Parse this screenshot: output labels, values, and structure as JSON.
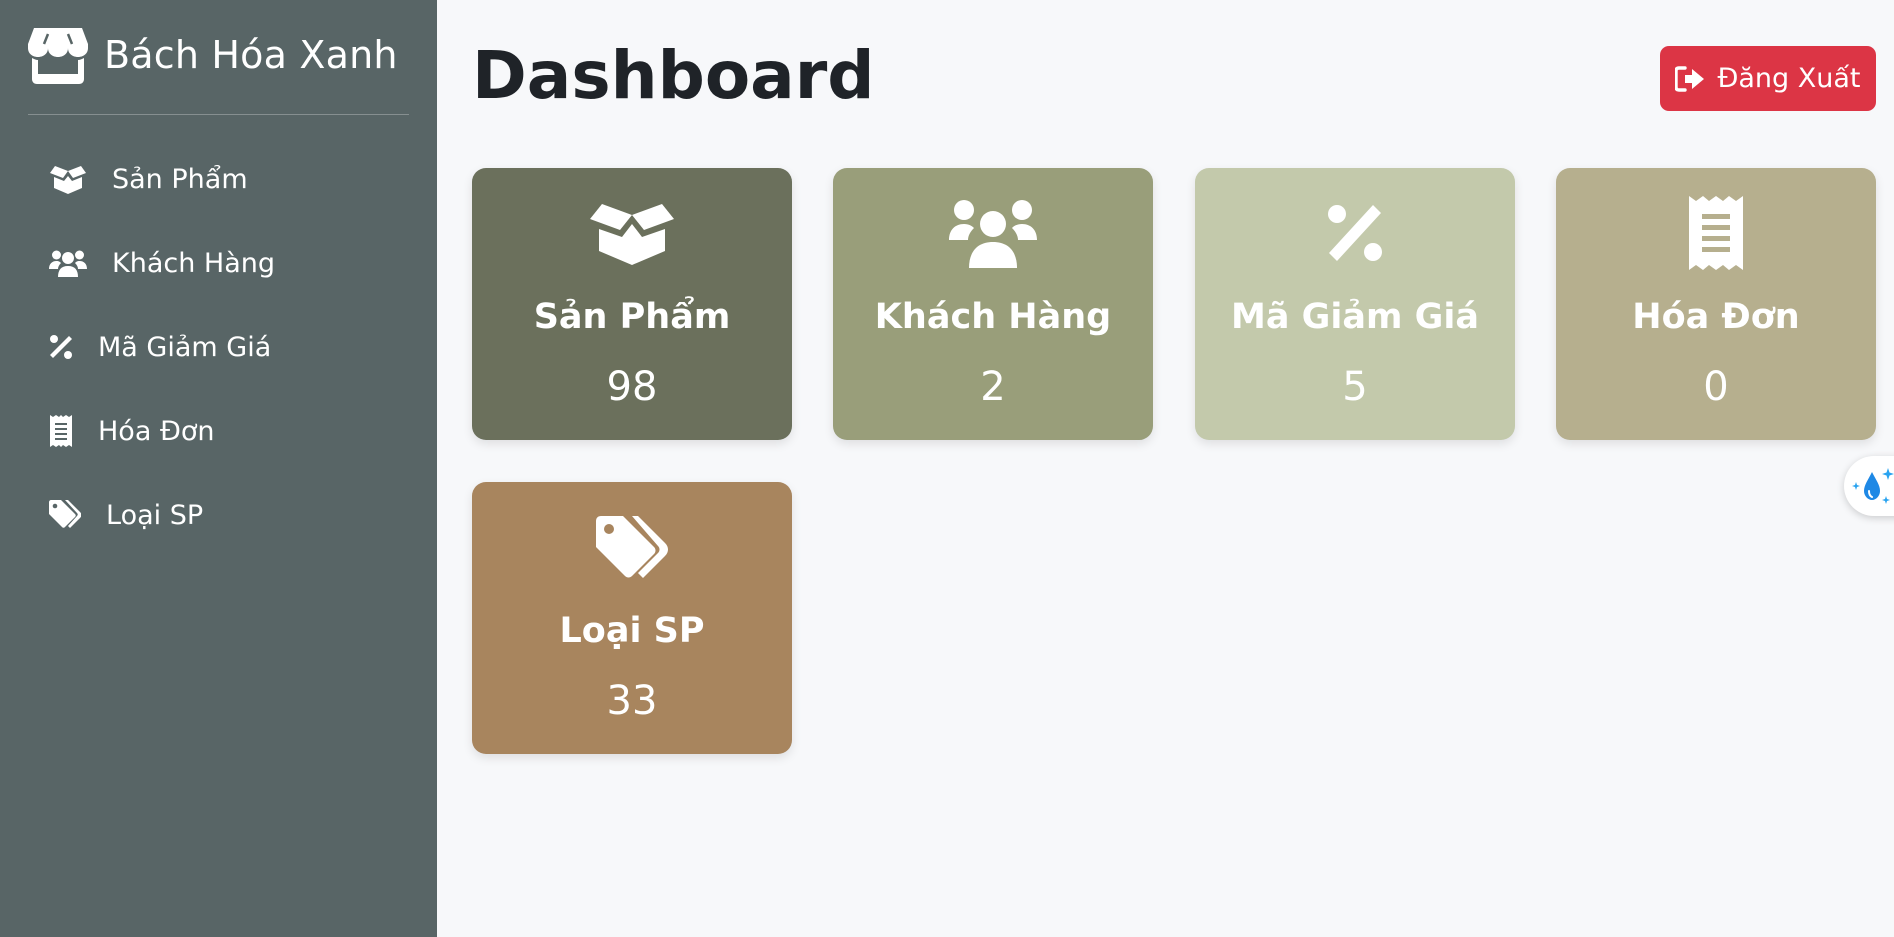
{
  "app": {
    "brand": "Bách Hóa Xanh",
    "brand_icon": "store-icon"
  },
  "sidebar": {
    "items": [
      {
        "label": "Sản Phẩm",
        "icon": "box-open-icon"
      },
      {
        "label": "Khách Hàng",
        "icon": "users-icon"
      },
      {
        "label": "Mã Giảm Giá",
        "icon": "percent-icon"
      },
      {
        "label": "Hóa Đơn",
        "icon": "receipt-icon"
      },
      {
        "label": "Loại SP",
        "icon": "tags-icon"
      }
    ]
  },
  "header": {
    "title": "Dashboard",
    "logout_label": "Đăng Xuất",
    "logout_icon": "sign-out-icon"
  },
  "cards": [
    {
      "label": "Sản Phẩm",
      "value": "98",
      "icon": "box-open-icon",
      "color": "#6b705c"
    },
    {
      "label": "Khách Hàng",
      "value": "2",
      "icon": "users-icon",
      "color": "#999e7a"
    },
    {
      "label": "Mã Giảm Giá",
      "value": "5",
      "icon": "percent-icon",
      "color": "#c3c9ab"
    },
    {
      "label": "Hóa Đơn",
      "value": "0",
      "icon": "receipt-icon",
      "color": "#b6af8e"
    },
    {
      "label": "Loại SP",
      "value": "33",
      "icon": "tags-icon",
      "color": "#a8855e"
    }
  ],
  "colors": {
    "sidebar_bg": "#586566",
    "page_bg": "#f7f8fa",
    "logout_bg": "#dc3545",
    "title_text": "#1f2328"
  },
  "floating_widget": {
    "icon": "water-drop-sparkle-icon"
  }
}
